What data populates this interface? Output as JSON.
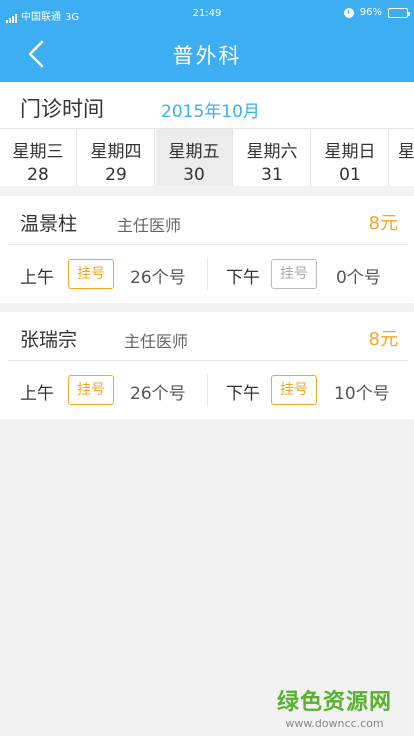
{
  "status_bar": {
    "carrier": "中国联通",
    "network": "3G",
    "time": "21:49",
    "battery": "96%",
    "battery_level": 0.96
  },
  "nav": {
    "title": "普外科"
  },
  "schedule": {
    "label": "门诊时间",
    "month": "2015年10月"
  },
  "dates": [
    {
      "day": "星期三",
      "num": "28"
    },
    {
      "day": "星期四",
      "num": "29"
    },
    {
      "day": "星期五",
      "num": "30",
      "selected": true
    },
    {
      "day": "星期六",
      "num": "31"
    },
    {
      "day": "星期日",
      "num": "01"
    },
    {
      "day": "星",
      "num": ""
    }
  ],
  "doctors": [
    {
      "name": "温景柱",
      "title": "主任医师",
      "price": "8元",
      "am_label": "上午",
      "am_button": "挂号",
      "am_count": "26个号",
      "am_available": true,
      "pm_label": "下午",
      "pm_button": "挂号",
      "pm_count": "0个号",
      "pm_available": false
    },
    {
      "name": "张瑞宗",
      "title": "主任医师",
      "price": "8元",
      "am_label": "上午",
      "am_button": "挂号",
      "am_count": "26个号",
      "am_available": true,
      "pm_label": "下午",
      "pm_button": "挂号",
      "pm_count": "10个号",
      "pm_available": true
    }
  ],
  "watermark": {
    "main": "绿色资源网",
    "url": "www.downcc.com"
  },
  "colors": {
    "primary": "#3eaef2",
    "accent": "#f5a623",
    "disabled": "#bbbbbb",
    "watermark": "#58b22e"
  }
}
